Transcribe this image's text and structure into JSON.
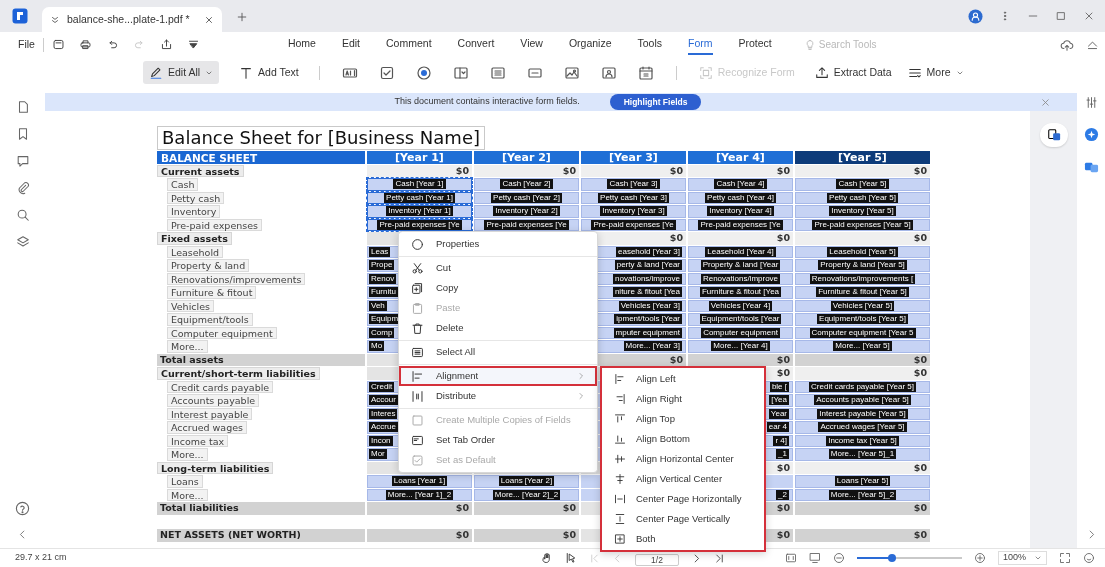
{
  "title_bar": {
    "tab": {
      "title": "balance-she...plate-1.pdf *"
    }
  },
  "menu_bar": {
    "file": "File",
    "quick_actions": [
      {
        "disabled": false
      },
      {
        "disabled": false
      },
      {
        "disabled": false
      },
      {
        "disabled": true
      },
      {
        "disabled": false
      },
      {
        "disabled": false
      }
    ],
    "tabs": [
      {
        "label": "Home",
        "selected": false
      },
      {
        "label": "Edit",
        "selected": false
      },
      {
        "label": "Comment",
        "selected": false
      },
      {
        "label": "Convert",
        "selected": false
      },
      {
        "label": "View",
        "selected": false
      },
      {
        "label": "Organize",
        "selected": false
      },
      {
        "label": "Tools",
        "selected": false
      },
      {
        "label": "Form",
        "selected": true
      },
      {
        "label": "Protect",
        "selected": false
      }
    ],
    "search": {
      "placeholder": "Search Tools"
    }
  },
  "toolbar": {
    "edit_all": {
      "label": "Edit All",
      "active": true
    },
    "add_text": {
      "label": "Add Text"
    },
    "recognize_form": {
      "label": "Recognize Form",
      "disabled": true
    },
    "extract_data": {
      "label": "Extract Data"
    },
    "more": {
      "label": "More"
    }
  },
  "notice": {
    "message": "This document contains interactive form fields.",
    "button": "Highlight Fields"
  },
  "document": {
    "title": "Balance Sheet for [Business Name]",
    "header": {
      "label": "BALANCE SHEET",
      "years": [
        {
          "label": "[Year 1]",
          "color": "#1f6fd6"
        },
        {
          "label": "[Year 2]",
          "color": "#1f6fd6"
        },
        {
          "label": "[Year 3]",
          "color": "#1f6fd6"
        },
        {
          "label": "[Year 4]",
          "color": "#1f6fd6"
        },
        {
          "label": "[Year 5]",
          "color": "#0d3b7a"
        }
      ]
    },
    "rows": [
      {
        "kind": "section",
        "label": "Current assets",
        "cells": [
          {
            "kind": "amount",
            "text": "$0"
          },
          {
            "kind": "amount",
            "text": "$0"
          },
          {
            "kind": "amount",
            "text": "$0"
          },
          {
            "kind": "amount",
            "text": "$0"
          },
          {
            "kind": "amount",
            "text": "$0"
          }
        ]
      },
      {
        "kind": "item",
        "label": "Cash",
        "cells": [
          {
            "kind": "field",
            "text": "Cash [Year 1]",
            "selected": true
          },
          {
            "kind": "field",
            "text": "Cash [Year 2]",
            "selected": false
          },
          {
            "kind": "field",
            "text": "Cash [Year 3]",
            "selected": false
          },
          {
            "kind": "field",
            "text": "Cash [Year 4]",
            "selected": false
          },
          {
            "kind": "field",
            "text": "Cash [Year 5]",
            "selected": false
          }
        ]
      },
      {
        "kind": "item",
        "label": "Petty cash",
        "cells": [
          {
            "kind": "field",
            "text": "Petty cash [Year 1]",
            "selected": true
          },
          {
            "kind": "field",
            "text": "Petty cash [Year 2]",
            "selected": false
          },
          {
            "kind": "field",
            "text": "Petty cash [Year 3]",
            "selected": false
          },
          {
            "kind": "field",
            "text": "Petty cash [Year 4]",
            "selected": false
          },
          {
            "kind": "field",
            "text": "Petty cash [Year 5]",
            "selected": false
          }
        ]
      },
      {
        "kind": "item",
        "label": "Inventory",
        "cells": [
          {
            "kind": "field",
            "text": "Inventory [Year 1]",
            "selected": true
          },
          {
            "kind": "field",
            "text": "Inventory [Year 2]",
            "selected": false
          },
          {
            "kind": "field",
            "text": "Inventory [Year 3]",
            "selected": false
          },
          {
            "kind": "field",
            "text": "Inventory [Year 4]",
            "selected": false
          },
          {
            "kind": "field",
            "text": "Inventory [Year 5]",
            "selected": false
          }
        ]
      },
      {
        "kind": "item",
        "label": "Pre-paid expenses",
        "cells": [
          {
            "kind": "field",
            "text": "Pre-paid expenses [Ye",
            "selected": true
          },
          {
            "kind": "field",
            "text": "Pre-paid expenses [Ye",
            "selected": false
          },
          {
            "kind": "field",
            "text": "Pre-paid expenses [Ye",
            "selected": false
          },
          {
            "kind": "field",
            "text": "Pre-paid expenses [Ye",
            "selected": false
          },
          {
            "kind": "field",
            "text": "Pre-paid expenses [Year 5]",
            "selected": false
          }
        ]
      },
      {
        "kind": "section",
        "label": "Fixed assets",
        "cells": [
          {
            "kind": "covered"
          },
          {
            "kind": "covered"
          },
          {
            "kind": "amount",
            "text": "$0"
          },
          {
            "kind": "amount",
            "text": "$0"
          },
          {
            "kind": "amount",
            "text": "$0"
          }
        ]
      },
      {
        "kind": "item",
        "label": "Leasehold",
        "cells": [
          {
            "kind": "field_left",
            "text": "Leas",
            "selected": false
          },
          {
            "kind": "covered"
          },
          {
            "kind": "field_right",
            "text": "easehold [Year 3]",
            "selected": false
          },
          {
            "kind": "field",
            "text": "Leasehold [Year 4]",
            "selected": false
          },
          {
            "kind": "field",
            "text": "Leasehold [Year 5]",
            "selected": false
          }
        ]
      },
      {
        "kind": "item",
        "label": "Property & land",
        "cells": [
          {
            "kind": "field_left",
            "text": "Prope",
            "selected": false
          },
          {
            "kind": "covered"
          },
          {
            "kind": "field_right",
            "text": "perty & land [Year",
            "selected": false
          },
          {
            "kind": "field",
            "text": "Property & land [Year",
            "selected": false
          },
          {
            "kind": "field",
            "text": "Property & land [Year 5]",
            "selected": false
          }
        ]
      },
      {
        "kind": "item",
        "label": "Renovations/improvements",
        "cells": [
          {
            "kind": "field_left",
            "text": "Renov",
            "selected": false
          },
          {
            "kind": "covered"
          },
          {
            "kind": "field_right",
            "text": "novations/improve",
            "selected": false
          },
          {
            "kind": "field",
            "text": "Renovations/improve",
            "selected": false
          },
          {
            "kind": "field",
            "text": "Renovations/improvements [",
            "selected": false
          }
        ]
      },
      {
        "kind": "item",
        "label": "Furniture & fitout",
        "cells": [
          {
            "kind": "field_left",
            "text": "Furnitu",
            "selected": false
          },
          {
            "kind": "covered"
          },
          {
            "kind": "field_right",
            "text": "niture & fitout [Yea",
            "selected": false
          },
          {
            "kind": "field",
            "text": "Furniture & fitout [Yea",
            "selected": false
          },
          {
            "kind": "field",
            "text": "Furniture & fitout [Year 5]",
            "selected": false
          }
        ]
      },
      {
        "kind": "item",
        "label": "Vehicles",
        "cells": [
          {
            "kind": "field_left",
            "text": "Veh",
            "selected": false
          },
          {
            "kind": "covered"
          },
          {
            "kind": "field_right",
            "text": "Vehicles [Year 3]",
            "selected": false
          },
          {
            "kind": "field",
            "text": "Vehicles [Year 4]",
            "selected": false
          },
          {
            "kind": "field",
            "text": "Vehicles [Year 5]",
            "selected": false
          }
        ]
      },
      {
        "kind": "item",
        "label": "Equipment/tools",
        "cells": [
          {
            "kind": "field_left",
            "text": "Equipm",
            "selected": false
          },
          {
            "kind": "covered"
          },
          {
            "kind": "field_right",
            "text": "ipment/tools [Year",
            "selected": false
          },
          {
            "kind": "field",
            "text": "Equipment/tools [Year",
            "selected": false
          },
          {
            "kind": "field",
            "text": "Equipment/tools [Year 5]",
            "selected": false
          }
        ]
      },
      {
        "kind": "item",
        "label": "Computer equipment",
        "cells": [
          {
            "kind": "field_left",
            "text": "Comp",
            "selected": false
          },
          {
            "kind": "covered"
          },
          {
            "kind": "field_right",
            "text": "mputer equipment",
            "selected": false
          },
          {
            "kind": "field",
            "text": "Computer equipment",
            "selected": false
          },
          {
            "kind": "field",
            "text": "Computer equipment [Year 5",
            "selected": false
          }
        ]
      },
      {
        "kind": "item",
        "label": "More...",
        "cells": [
          {
            "kind": "field_left",
            "text": "Mo",
            "selected": false
          },
          {
            "kind": "covered"
          },
          {
            "kind": "field_right",
            "text": "More... [Year 3]",
            "selected": false
          },
          {
            "kind": "field",
            "text": "More... [Year 4]",
            "selected": false
          },
          {
            "kind": "field",
            "text": "More... [Year 5]",
            "selected": false
          }
        ]
      },
      {
        "kind": "total",
        "label": "Total assets",
        "cells": [
          {
            "kind": "covered"
          },
          {
            "kind": "covered"
          },
          {
            "kind": "amount",
            "text": "$0"
          },
          {
            "kind": "amount",
            "text": "$0"
          },
          {
            "kind": "amount",
            "text": "$0"
          }
        ]
      },
      {
        "kind": "section",
        "label": "Current/short-term liabilities",
        "cells": [
          {
            "kind": "covered"
          },
          {
            "kind": "covered"
          },
          {
            "kind": "covered"
          },
          {
            "kind": "amount",
            "text": "$0"
          },
          {
            "kind": "amount",
            "text": "$0"
          }
        ]
      },
      {
        "kind": "item",
        "label": "Credit cards payable",
        "cells": [
          {
            "kind": "field_left",
            "text": "Credit",
            "selected": false
          },
          {
            "kind": "covered"
          },
          {
            "kind": "covered"
          },
          {
            "kind": "field_right",
            "text": "ble [",
            "selected": false
          },
          {
            "kind": "field",
            "text": "Credit cards payable [Year 5]",
            "selected": false
          }
        ]
      },
      {
        "kind": "item",
        "label": "Accounts payable",
        "cells": [
          {
            "kind": "field_left",
            "text": "Accour",
            "selected": false
          },
          {
            "kind": "covered"
          },
          {
            "kind": "covered"
          },
          {
            "kind": "field_right",
            "text": "[Yea",
            "selected": false
          },
          {
            "kind": "field",
            "text": "Accounts payable [Year 5]",
            "selected": false
          }
        ]
      },
      {
        "kind": "item",
        "label": "Interest payable",
        "cells": [
          {
            "kind": "field_left",
            "text": "Interes",
            "selected": false
          },
          {
            "kind": "covered"
          },
          {
            "kind": "covered"
          },
          {
            "kind": "field_right",
            "text": "Year",
            "selected": false
          },
          {
            "kind": "field",
            "text": "Interest payable [Year 5]",
            "selected": false
          }
        ]
      },
      {
        "kind": "item",
        "label": "Accrued wages",
        "cells": [
          {
            "kind": "field_left",
            "text": "Accrue",
            "selected": false
          },
          {
            "kind": "covered"
          },
          {
            "kind": "covered"
          },
          {
            "kind": "field_right",
            "text": "ear 4",
            "selected": false
          },
          {
            "kind": "field",
            "text": "Accrued wages [Year 5]",
            "selected": false
          }
        ]
      },
      {
        "kind": "item",
        "label": "Income tax",
        "cells": [
          {
            "kind": "field_left",
            "text": "Incon",
            "selected": false
          },
          {
            "kind": "covered"
          },
          {
            "kind": "covered"
          },
          {
            "kind": "field_right",
            "text": "r 4]",
            "selected": false
          },
          {
            "kind": "field",
            "text": "Income tax [Year 5]",
            "selected": false
          }
        ]
      },
      {
        "kind": "item",
        "label": "More...",
        "cells": [
          {
            "kind": "field_left",
            "text": "Mor",
            "selected": false
          },
          {
            "kind": "covered"
          },
          {
            "kind": "covered"
          },
          {
            "kind": "field_right",
            "text": "_1",
            "selected": false
          },
          {
            "kind": "field",
            "text": "More... [Year 5]_1",
            "selected": false
          }
        ]
      },
      {
        "kind": "section",
        "label": "Long-term liabilities",
        "cells": [
          {
            "kind": "covered"
          },
          {
            "kind": "covered"
          },
          {
            "kind": "covered"
          },
          {
            "kind": "amount",
            "text": "$0"
          },
          {
            "kind": "amount",
            "text": "$0"
          }
        ]
      },
      {
        "kind": "item",
        "label": "Loans",
        "cells": [
          {
            "kind": "field",
            "text": "Loans [Year 1]",
            "selected": false
          },
          {
            "kind": "field",
            "text": "Loans [Year 2]",
            "selected": false
          },
          {
            "kind": "covered"
          },
          {
            "kind": "covered"
          },
          {
            "kind": "field",
            "text": "Loans [Year 5]",
            "selected": false
          }
        ]
      },
      {
        "kind": "item",
        "label": "More...",
        "cells": [
          {
            "kind": "field",
            "text": "More... [Year 1]_2",
            "selected": false
          },
          {
            "kind": "field",
            "text": "More... [Year 2]_2",
            "selected": false
          },
          {
            "kind": "covered"
          },
          {
            "kind": "field_right",
            "text": "_2",
            "selected": false
          },
          {
            "kind": "field",
            "text": "More... [Year 5]_2",
            "selected": false
          }
        ]
      },
      {
        "kind": "total",
        "label": "Total liabilities",
        "cells": [
          {
            "kind": "amount",
            "text": "$0"
          },
          {
            "kind": "amount",
            "text": "$0"
          },
          {
            "kind": "covered"
          },
          {
            "kind": "amount",
            "text": "$0"
          },
          {
            "kind": "amount",
            "text": "$0"
          }
        ]
      },
      {
        "kind": "spacer"
      },
      {
        "kind": "total",
        "label": "NET ASSETS (NET WORTH)",
        "cells": [
          {
            "kind": "amount",
            "text": "$0"
          },
          {
            "kind": "amount",
            "text": "$0"
          },
          {
            "kind": "covered"
          },
          {
            "kind": "amount",
            "text": "$0"
          },
          {
            "kind": "amount",
            "text": "$0"
          }
        ]
      }
    ]
  },
  "context_menu": {
    "items": [
      {
        "kind": "item",
        "label": "Properties",
        "disabled": false,
        "highlighted": false,
        "has_submenu": false
      },
      {
        "kind": "divider"
      },
      {
        "kind": "item",
        "label": "Cut",
        "disabled": false,
        "highlighted": false,
        "has_submenu": false
      },
      {
        "kind": "item",
        "label": "Copy",
        "disabled": false,
        "highlighted": false,
        "has_submenu": false
      },
      {
        "kind": "item",
        "label": "Paste",
        "disabled": true,
        "highlighted": false,
        "has_submenu": false
      },
      {
        "kind": "item",
        "label": "Delete",
        "disabled": false,
        "highlighted": false,
        "has_submenu": false
      },
      {
        "kind": "divider"
      },
      {
        "kind": "item",
        "label": "Select All",
        "disabled": false,
        "highlighted": false,
        "has_submenu": false
      },
      {
        "kind": "divider"
      },
      {
        "kind": "item",
        "label": "Alignment",
        "disabled": false,
        "highlighted": true,
        "has_submenu": true
      },
      {
        "kind": "item",
        "label": "Distribute",
        "disabled": false,
        "highlighted": false,
        "has_submenu": true
      },
      {
        "kind": "divider"
      },
      {
        "kind": "item",
        "label": "Create Multiple Copies of Fields",
        "disabled": true,
        "highlighted": false,
        "has_submenu": false
      },
      {
        "kind": "item",
        "label": "Set Tab Order",
        "disabled": false,
        "highlighted": false,
        "has_submenu": false
      },
      {
        "kind": "item",
        "label": "Set as Default",
        "disabled": true,
        "highlighted": false,
        "has_submenu": false
      }
    ]
  },
  "submenu": {
    "highlighted": true,
    "items": [
      {
        "label": "Align Left"
      },
      {
        "label": "Align Right"
      },
      {
        "label": "Align Top"
      },
      {
        "label": "Align Bottom"
      },
      {
        "label": "Align Horizontal Center"
      },
      {
        "label": "Align Vertical Center"
      },
      {
        "label": "Center Page Horizontally"
      },
      {
        "label": "Center Page Vertically"
      },
      {
        "label": "Both"
      }
    ]
  },
  "status_bar": {
    "page_size": "29.7 x 21 cm",
    "nav": [
      {
        "disabled": true
      },
      {
        "disabled": true
      },
      {
        "disabled": false
      },
      {
        "disabled": false
      }
    ],
    "page": "1/2",
    "zoom": {
      "level": 0.33
    },
    "zoom_text": "100%"
  }
}
